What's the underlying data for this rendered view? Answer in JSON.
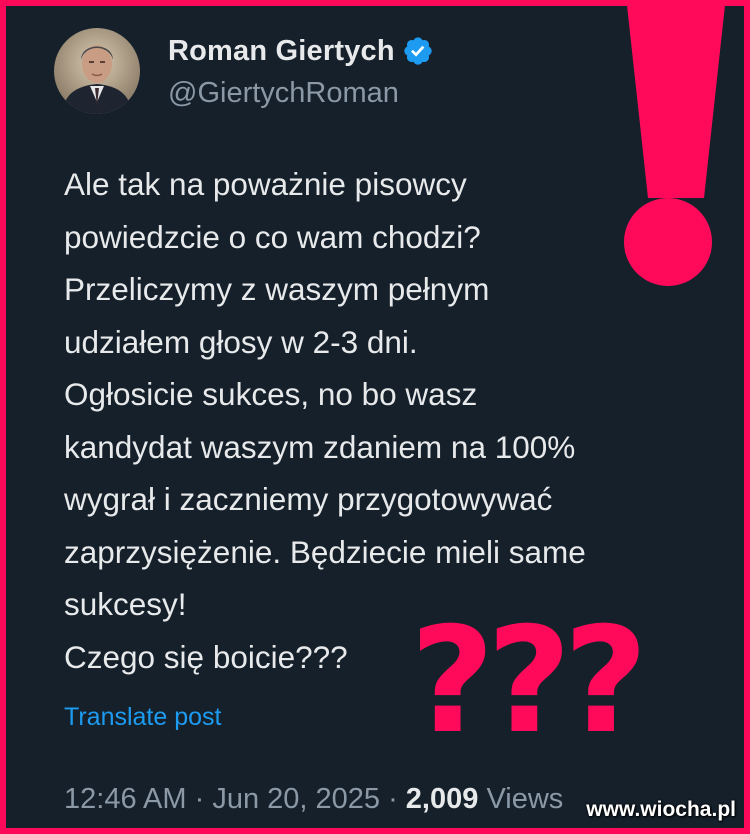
{
  "post": {
    "author": {
      "display_name": "Roman Giertych",
      "handle": "@GiertychRoman",
      "verified": true,
      "avatar_icon": "person-portrait"
    },
    "text": "Ale tak na poważnie pisowcy\npowiedzcie o co wam chodzi?\nPrzeliczymy z waszym pełnym\nudziałem głosy w 2-3 dni.\nOgłosicie sukces, no bo wasz\nkandydat waszym zdaniem na 100%\nwygrał i zaczniemy przygotowywać\nzaprzysiężenie. Będziecie mieli same\nsukcesy!\nCzego się boicie???",
    "translate_label": "Translate post",
    "time": "12:46 AM",
    "separator": " · ",
    "date": "Jun 20, 2025",
    "views_count": "2,009",
    "views_label": "Views"
  },
  "overlay": {
    "exclamation_icon": "exclamation-mark",
    "question_marks": "???",
    "watermark": "www.wiocha.pl"
  },
  "colors": {
    "background": "#15202b",
    "frame": "#ff0a5a",
    "text": "#e7e9ea",
    "muted": "#8b98a5",
    "link": "#1d9bf0",
    "verified": "#1d9bf0"
  }
}
